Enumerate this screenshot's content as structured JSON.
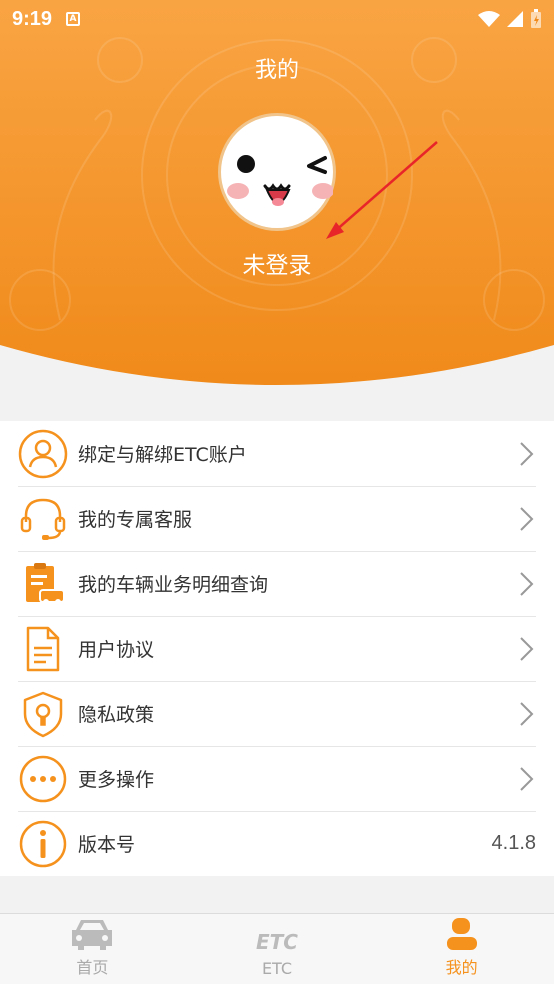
{
  "status_bar": {
    "time": "9:19",
    "notification_badge": "A"
  },
  "header": {
    "title": "我的",
    "login_status": "未登录"
  },
  "menu": {
    "items": [
      {
        "label": "绑定与解绑ETC账户",
        "icon": "user-icon"
      },
      {
        "label": "我的专属客服",
        "icon": "headset-icon"
      },
      {
        "label": "我的车辆业务明细查询",
        "icon": "clipboard-car-icon"
      },
      {
        "label": "用户协议",
        "icon": "document-icon"
      },
      {
        "label": "隐私政策",
        "icon": "shield-lock-icon"
      },
      {
        "label": "更多操作",
        "icon": "more-icon"
      },
      {
        "label": "版本号",
        "icon": "info-icon",
        "value": "4.1.8"
      }
    ]
  },
  "tabbar": {
    "tabs": [
      {
        "label": "首页",
        "icon": "car-icon",
        "active": false
      },
      {
        "label": "ETC",
        "icon": "etc-logo-icon",
        "logo_text": "ETC",
        "active": false
      },
      {
        "label": "我的",
        "icon": "profile-icon",
        "active": true
      }
    ]
  },
  "colors": {
    "accent": "#f5921e",
    "header_start": "#f9a443",
    "header_end": "#f08a1a",
    "inactive": "#aaaaaa",
    "annotation_arrow": "#e8262a"
  }
}
